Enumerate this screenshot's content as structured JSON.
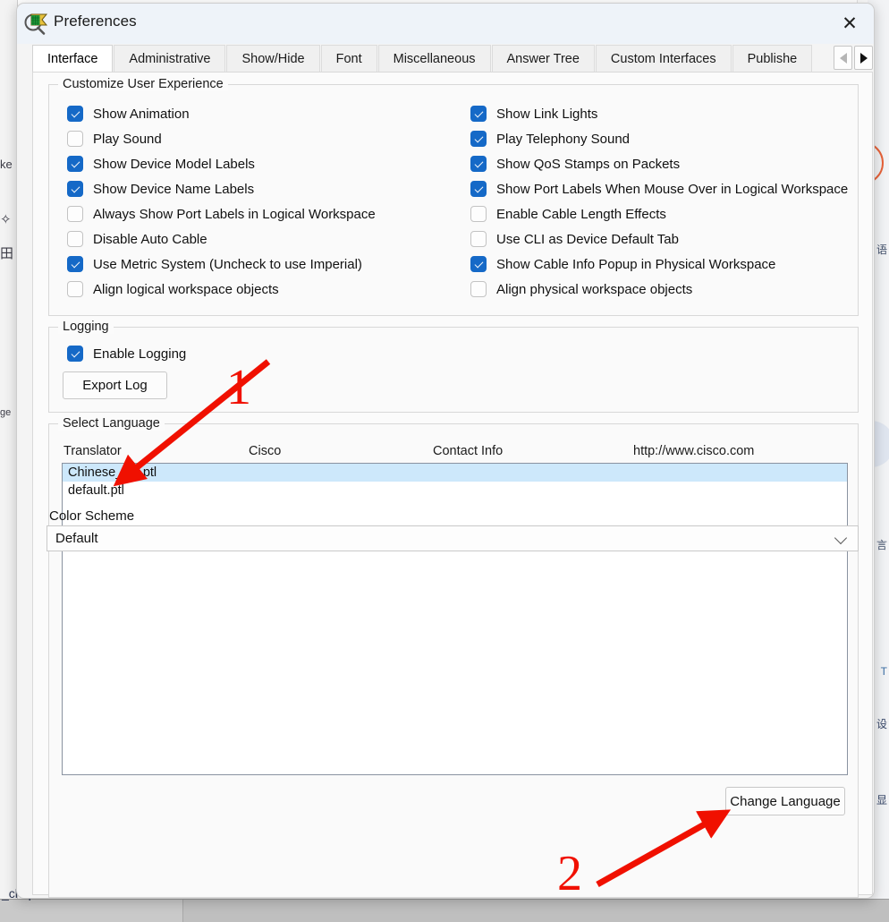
{
  "window": {
    "title": "Preferences",
    "icon": "preferences-magnifier-icon",
    "close_label": "✕"
  },
  "tabs": {
    "items": [
      {
        "label": "Interface",
        "active": true
      },
      {
        "label": "Administrative",
        "active": false
      },
      {
        "label": "Show/Hide",
        "active": false
      },
      {
        "label": "Font",
        "active": false
      },
      {
        "label": "Miscellaneous",
        "active": false
      },
      {
        "label": "Answer Tree",
        "active": false
      },
      {
        "label": "Custom Interfaces",
        "active": false
      },
      {
        "label": "Publishe",
        "active": false
      }
    ],
    "scroll_left": "◀",
    "scroll_right": "▶"
  },
  "customize": {
    "legend": "Customize User Experience",
    "left_column": [
      {
        "label": "Show Animation",
        "checked": true
      },
      {
        "label": "Play Sound",
        "checked": false
      },
      {
        "label": "Show Device Model Labels",
        "checked": true
      },
      {
        "label": "Show Device Name Labels",
        "checked": true
      },
      {
        "label": "Always Show Port Labels in Logical Workspace",
        "checked": false
      },
      {
        "label": "Disable Auto Cable",
        "checked": false
      },
      {
        "label": "Use Metric System (Uncheck to use Imperial)",
        "checked": true
      },
      {
        "label": "Align logical workspace objects",
        "checked": false
      }
    ],
    "right_column": [
      {
        "label": "Show Link Lights",
        "checked": true
      },
      {
        "label": "Play Telephony Sound",
        "checked": true
      },
      {
        "label": "Show QoS Stamps on Packets",
        "checked": true
      },
      {
        "label": "Show Port Labels When Mouse Over in Logical Workspace",
        "checked": true
      },
      {
        "label": "Enable Cable Length Effects",
        "checked": false
      },
      {
        "label": "Use CLI as Device Default Tab",
        "checked": false
      },
      {
        "label": "Show Cable Info Popup in Physical Workspace",
        "checked": true
      },
      {
        "label": "Align physical workspace objects",
        "checked": false
      }
    ]
  },
  "logging": {
    "legend": "Logging",
    "enable_label": "Enable Logging",
    "enable_checked": true,
    "export_button": "Export Log"
  },
  "select_language": {
    "legend": "Select Language",
    "columns": [
      "Translator",
      "Cisco",
      "Contact Info",
      "http://www.cisco.com"
    ],
    "items": [
      {
        "name": "Chinese_chi.ptl",
        "selected": true
      },
      {
        "name": "default.ptl",
        "selected": false
      }
    ],
    "change_button": "Change Language"
  },
  "color_scheme": {
    "label": "Color Scheme",
    "value": "Default"
  },
  "annotations": {
    "step_one": "1",
    "step_two": "2",
    "color": "#f01000"
  },
  "background": {
    "left_label": "ge",
    "bottom_label": "_chi.ptl",
    "right_labels": [
      "语",
      "言",
      "T",
      "设",
      "显"
    ]
  }
}
